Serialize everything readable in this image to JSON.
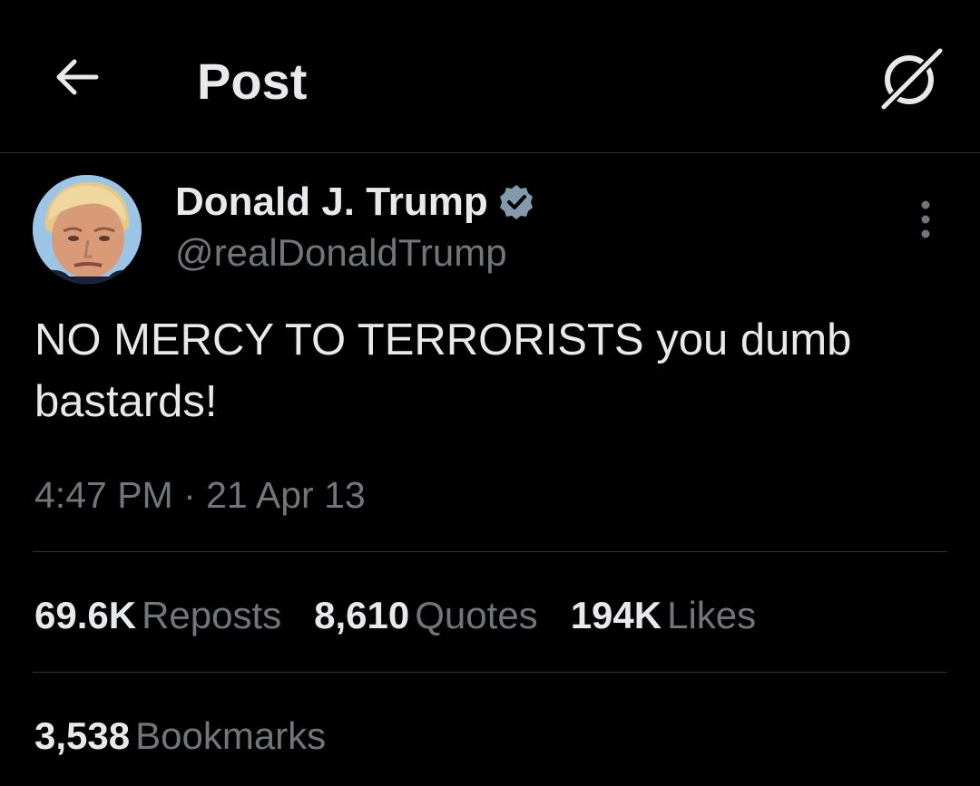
{
  "header": {
    "title": "Post",
    "back_icon": "arrow-left-icon",
    "grok_icon": "grok-icon"
  },
  "post": {
    "author": {
      "name": "Donald J. Trump",
      "handle": "@realDonaldTrump",
      "verified": true,
      "badge_color": "#829aab"
    },
    "text": "NO MERCY TO TERRORISTS you dumb bastards!",
    "timestamp": "4:47 PM · 21 Apr 13",
    "more_icon": "more-vertical-icon"
  },
  "stats": {
    "reposts": {
      "count": "69.6K",
      "label": "Reposts"
    },
    "quotes": {
      "count": "8,610",
      "label": "Quotes"
    },
    "likes": {
      "count": "194K",
      "label": "Likes"
    },
    "bookmarks": {
      "count": "3,538",
      "label": "Bookmarks"
    }
  },
  "colors": {
    "background": "#000000",
    "text_primary": "#e7e9ea",
    "text_secondary": "#71767b",
    "divider": "#2f3336"
  }
}
